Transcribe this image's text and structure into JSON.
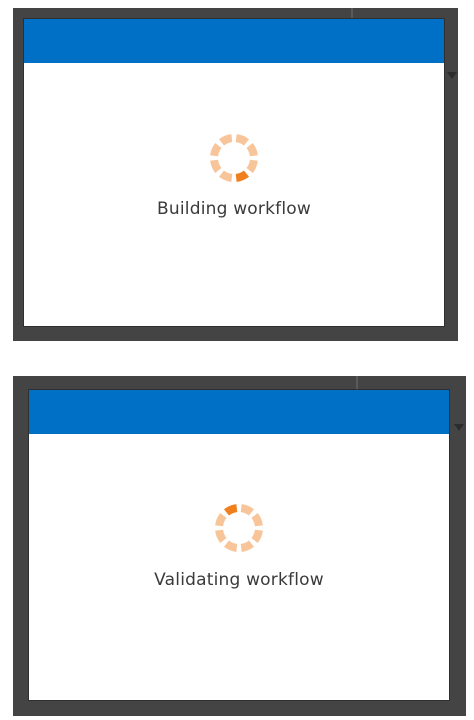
{
  "colors": {
    "frame": "#444444",
    "header": "#0070c6",
    "spinner_light": "#f8c59a",
    "spinner_active": "#f07f1d",
    "text": "#3a3a3a"
  },
  "panels": [
    {
      "status_text": "Building workflow",
      "spinner_icon": "loading-spinner-icon"
    },
    {
      "status_text": "Validating workflow",
      "spinner_icon": "loading-spinner-icon"
    }
  ]
}
